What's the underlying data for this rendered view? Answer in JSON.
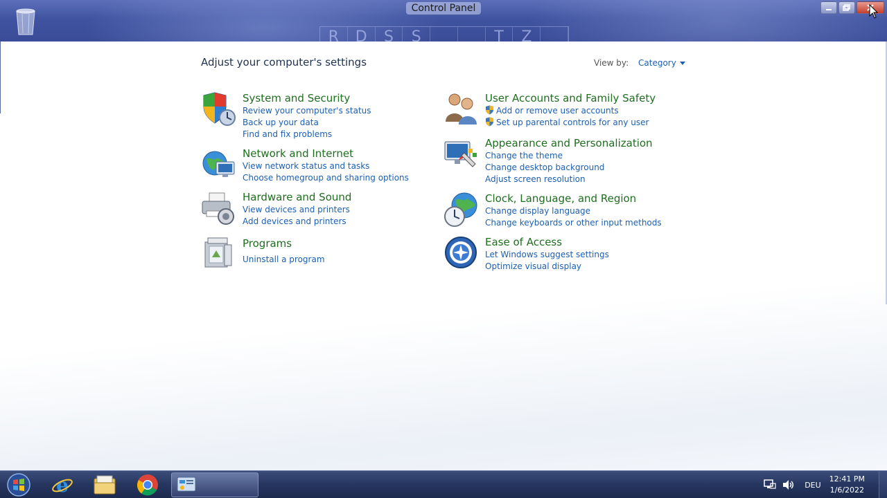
{
  "window": {
    "title": "Control Panel",
    "address_letters": [
      "R",
      "D",
      "S",
      "S",
      "",
      "",
      "T",
      "Z",
      ""
    ]
  },
  "content": {
    "headline": "Adjust your computer's settings",
    "view_by": {
      "label": "View by:",
      "value": "Category"
    },
    "categories": [
      {
        "title": "System and Security",
        "icon": "shield-icon",
        "links": [
          "Review your computer's status",
          "Back up your data",
          "Find and fix problems"
        ]
      },
      {
        "title": "Network and Internet",
        "icon": "network-globe-icon",
        "links": [
          "View network status and tasks",
          "Choose homegroup and sharing options"
        ]
      },
      {
        "title": "Hardware and Sound",
        "icon": "printer-icon",
        "links": [
          "View devices and printers",
          "Add devices and printers"
        ]
      },
      {
        "title": "Programs",
        "icon": "programs-icon",
        "links": [
          "Uninstall a program"
        ]
      },
      {
        "title": "User Accounts and Family Safety",
        "icon": "users-icon",
        "links": [
          "Add or remove user accounts",
          "Set up parental controls for any user"
        ]
      },
      {
        "title": "Appearance and Personalization",
        "icon": "monitor-paint-icon",
        "links": [
          "Change the theme",
          "Change desktop background",
          "Adjust screen resolution"
        ]
      },
      {
        "title": "Clock, Language, and Region",
        "icon": "globe-clock-icon",
        "links": [
          "Change display language",
          "Change keyboards or other input methods"
        ]
      },
      {
        "title": "Ease of Access",
        "icon": "ease-of-access-icon",
        "links": [
          "Let Windows suggest settings",
          "Optimize visual display"
        ]
      }
    ]
  },
  "taskbar": {
    "language": "DEU",
    "time": "12:41 PM",
    "date": "1/6/2022"
  },
  "colors": {
    "title_green": "#1e6e1e",
    "link_blue": "#1a5fb4",
    "taskbar": "#26365f"
  }
}
